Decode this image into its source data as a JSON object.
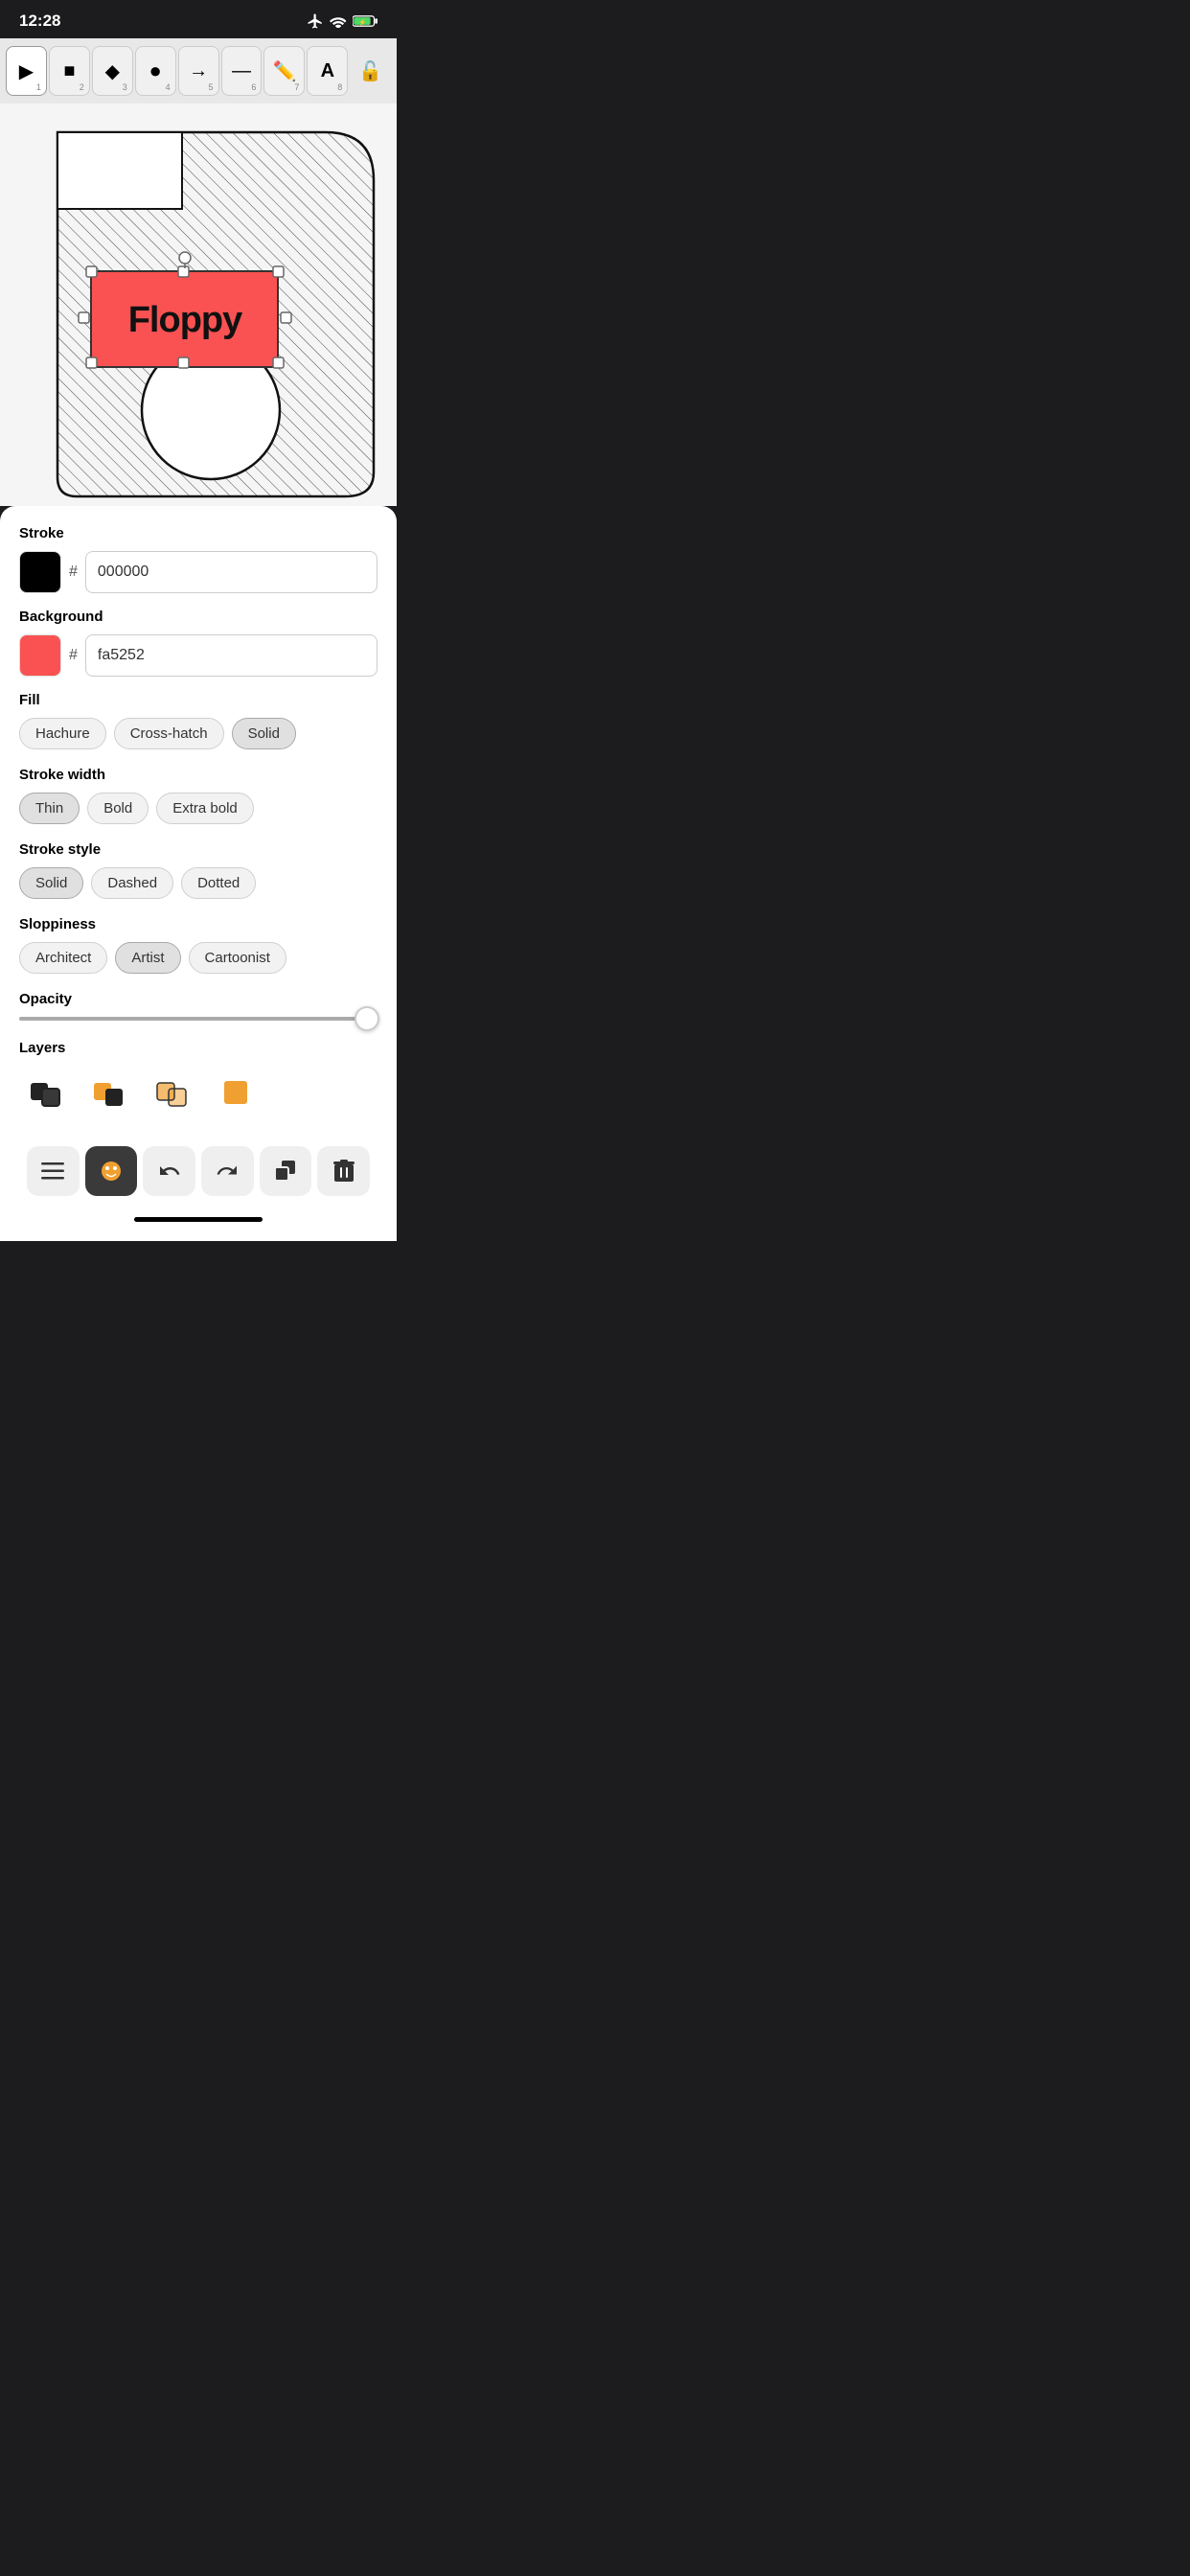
{
  "statusBar": {
    "time": "12:28"
  },
  "toolbar": {
    "tools": [
      {
        "id": "select",
        "label": "▶",
        "num": "1",
        "active": true
      },
      {
        "id": "rect",
        "label": "■",
        "num": "2",
        "active": false
      },
      {
        "id": "diamond",
        "label": "◆",
        "num": "3",
        "active": false
      },
      {
        "id": "circle",
        "label": "●",
        "num": "4",
        "active": false
      },
      {
        "id": "arrow",
        "label": "→",
        "num": "5",
        "active": false
      },
      {
        "id": "line",
        "label": "—",
        "num": "6",
        "active": false
      },
      {
        "id": "pencil",
        "label": "✎",
        "num": "7",
        "active": false
      },
      {
        "id": "text",
        "label": "A",
        "num": "8",
        "active": false
      }
    ]
  },
  "canvas": {
    "label": "Floppy"
  },
  "panel": {
    "strokeLabel": "Stroke",
    "strokeColor": "#000000",
    "strokeHex": "000000",
    "backgroundLabel": "Background",
    "bgColor": "#fa5252",
    "bgHex": "fa5252",
    "fillLabel": "Fill",
    "fillOptions": [
      {
        "id": "hachure",
        "label": "Hachure",
        "selected": false
      },
      {
        "id": "cross-hatch",
        "label": "Cross-hatch",
        "selected": false
      },
      {
        "id": "solid",
        "label": "Solid",
        "selected": true
      }
    ],
    "strokeWidthLabel": "Stroke width",
    "strokeWidthOptions": [
      {
        "id": "thin",
        "label": "Thin",
        "selected": true
      },
      {
        "id": "bold",
        "label": "Bold",
        "selected": false
      },
      {
        "id": "extra-bold",
        "label": "Extra bold",
        "selected": false
      }
    ],
    "strokeStyleLabel": "Stroke style",
    "strokeStyleOptions": [
      {
        "id": "solid",
        "label": "Solid",
        "selected": true
      },
      {
        "id": "dashed",
        "label": "Dashed",
        "selected": false
      },
      {
        "id": "dotted",
        "label": "Dotted",
        "selected": false
      }
    ],
    "sloppinessLabel": "Sloppiness",
    "sloppinessOptions": [
      {
        "id": "architect",
        "label": "Architect",
        "selected": false
      },
      {
        "id": "artist",
        "label": "Artist",
        "selected": true
      },
      {
        "id": "cartoonist",
        "label": "Cartoonist",
        "selected": false
      }
    ],
    "opacityLabel": "Opacity",
    "opacityValue": 95,
    "layersLabel": "Layers"
  },
  "bottomToolbar": {
    "buttons": [
      {
        "id": "menu",
        "label": "☰",
        "active": false
      },
      {
        "id": "style",
        "label": "🎨",
        "active": true
      },
      {
        "id": "undo",
        "label": "↺",
        "active": false
      },
      {
        "id": "redo",
        "label": "↻",
        "active": false
      },
      {
        "id": "copy",
        "label": "⧉",
        "active": false
      },
      {
        "id": "delete",
        "label": "🗑",
        "active": false
      }
    ]
  }
}
